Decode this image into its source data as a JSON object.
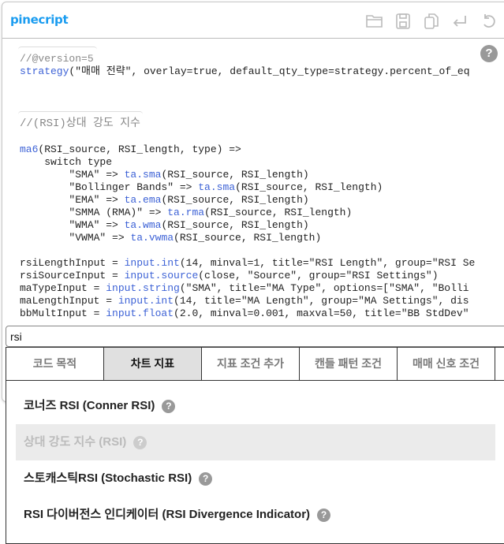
{
  "app": {
    "title": "pinecript"
  },
  "toolbar": {
    "icons": [
      "folder-open-icon",
      "save-icon",
      "copy-icon",
      "enter-icon",
      "undo-icon"
    ]
  },
  "editor": {
    "lines_block1": [
      "//@version=5",
      "strategy(\"매매 전략\", overlay=true, default_qty_type=strategy.percent_of_eq"
    ],
    "comment2": "//(RSI)상대 강도 지수",
    "lines_block2": [
      "ma6(RSI_source, RSI_length, type) =>",
      "    switch type",
      "        \"SMA\" => ta.sma(RSI_source, RSI_length)",
      "        \"Bollinger Bands\" => ta.sma(RSI_source, RSI_length)",
      "        \"EMA\" => ta.ema(RSI_source, RSI_length)",
      "        \"SMMA (RMA)\" => ta.rma(RSI_source, RSI_length)",
      "        \"WMA\" => ta.wma(RSI_source, RSI_length)",
      "        \"VWMA\" => ta.vwma(RSI_source, RSI_length)",
      "",
      "rsiLengthInput = input.int(14, minval=1, title=\"RSI Length\", group=\"RSI Se",
      "rsiSourceInput = input.source(close, \"Source\", group=\"RSI Settings\")",
      "maTypeInput = input.string(\"SMA\", title=\"MA Type\", options=[\"SMA\", \"Bolli",
      "maLengthInput = input.int(14, title=\"MA Length\", group=\"MA Settings\", dis",
      "bbMultInput = input.float(2.0, minval=0.001, maxval=50, title=\"BB StdDev\""
    ]
  },
  "search": {
    "value": "rsi"
  },
  "tabs": [
    {
      "label": "코드 목적",
      "active": false
    },
    {
      "label": "차트 지표",
      "active": true
    },
    {
      "label": "지표 조건 추가",
      "active": false
    },
    {
      "label": "캔들 패턴 조건",
      "active": false
    },
    {
      "label": "매매 신호 조건",
      "active": false
    }
  ],
  "results": [
    {
      "label": "코너즈 RSI (Conner RSI)",
      "disabled": false
    },
    {
      "label": "상대 강도 지수 (RSI)",
      "disabled": true
    },
    {
      "label": "스토캐스틱RSI (Stochastic RSI)",
      "disabled": false
    },
    {
      "label": "RSI 다이버전스 인디케이터 (RSI Divergence Indicator)",
      "disabled": false
    }
  ],
  "help_glyph": "?",
  "colors": {
    "brand": "#1a9cf0",
    "function": "#3d62d6",
    "comment": "#888888"
  }
}
